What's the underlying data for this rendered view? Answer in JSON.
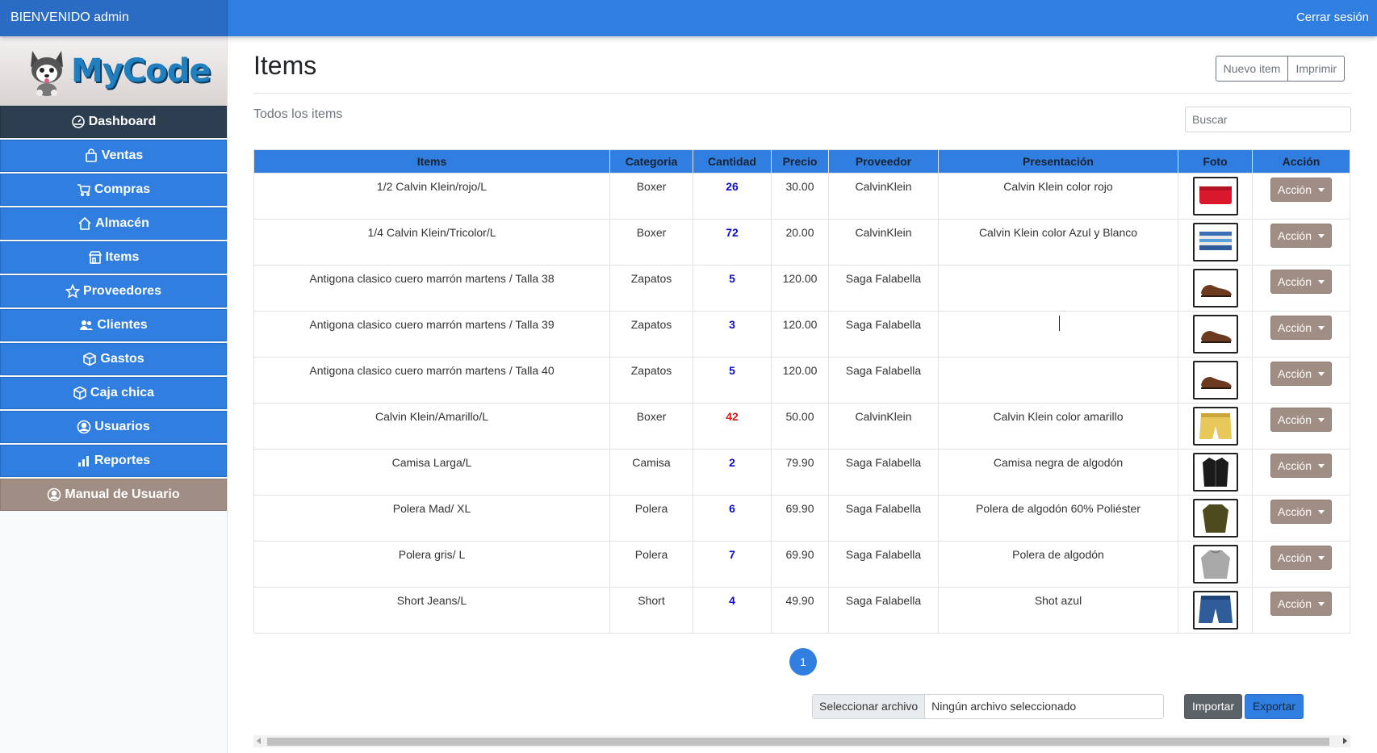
{
  "topbar": {
    "welcome": "BIENVENIDO admin",
    "logout": "Cerrar sesión"
  },
  "logo": {
    "text": "MyCode"
  },
  "sidebar": {
    "items": [
      {
        "label": "Dashboard",
        "icon": "dashboard-icon"
      },
      {
        "label": "Ventas",
        "icon": "shopping-bag-icon"
      },
      {
        "label": "Compras",
        "icon": "cart-icon"
      },
      {
        "label": "Almacén",
        "icon": "home-icon"
      },
      {
        "label": "Items",
        "icon": "shop-icon"
      },
      {
        "label": "Proveedores",
        "icon": "star-icon"
      },
      {
        "label": "Clientes",
        "icon": "people-icon"
      },
      {
        "label": "Gastos",
        "icon": "box-icon"
      },
      {
        "label": "Caja chica",
        "icon": "box-icon"
      },
      {
        "label": "Usuarios",
        "icon": "user-circle-icon"
      },
      {
        "label": "Reportes",
        "icon": "bar-chart-icon"
      },
      {
        "label": "Manual de Usuario",
        "icon": "user-circle-icon"
      }
    ]
  },
  "main": {
    "title": "Items",
    "buttons": {
      "new_item": "Nuevo item",
      "print": "Imprimir"
    },
    "subtitle": "Todos los items",
    "search_placeholder": "Buscar",
    "table": {
      "headers": [
        "Items",
        "Categoria",
        "Cantidad",
        "Precio",
        "Proveedor",
        "Presentación",
        "Foto",
        "Acción"
      ],
      "rows": [
        {
          "item": "1/2 Calvin Klein/rojo/L",
          "categoria": "Boxer",
          "cantidad": "26",
          "precio": "30.00",
          "proveedor": "CalvinKlein",
          "presentacion": "Calvin Klein color rojo",
          "accion": "Acción"
        },
        {
          "item": "1/4 Calvin Klein/Tricolor/L",
          "categoria": "Boxer",
          "cantidad": "72",
          "precio": "20.00",
          "proveedor": "CalvinKlein",
          "presentacion": "Calvin Klein color Azul y Blanco",
          "accion": "Acción"
        },
        {
          "item": "Antigona clasico cuero marrón martens / Talla 38",
          "categoria": "Zapatos",
          "cantidad": "5",
          "precio": "120.00",
          "proveedor": "Saga Falabella",
          "presentacion": "",
          "accion": "Acción"
        },
        {
          "item": "Antigona clasico cuero marrón martens / Talla 39",
          "categoria": "Zapatos",
          "cantidad": "3",
          "precio": "120.00",
          "proveedor": "Saga Falabella",
          "presentacion": "",
          "accion": "Acción"
        },
        {
          "item": "Antigona clasico cuero marrón martens / Talla 40",
          "categoria": "Zapatos",
          "cantidad": "5",
          "precio": "120.00",
          "proveedor": "Saga Falabella",
          "presentacion": "",
          "accion": "Acción"
        },
        {
          "item": "Calvin Klein/Amarillo/L",
          "categoria": "Boxer",
          "cantidad": "42",
          "precio": "50.00",
          "proveedor": "CalvinKlein",
          "presentacion": "Calvin Klein color amarillo",
          "accion": "Acción"
        },
        {
          "item": "Camisa Larga/L",
          "categoria": "Camisa",
          "cantidad": "2",
          "precio": "79.90",
          "proveedor": "Saga Falabella",
          "presentacion": "Camisa negra de algodón",
          "accion": "Acción"
        },
        {
          "item": "Polera Mad/ XL",
          "categoria": "Polera",
          "cantidad": "6",
          "precio": "69.90",
          "proveedor": "Saga Falabella",
          "presentacion": "Polera de algodón 60% Poliéster",
          "accion": "Acción"
        },
        {
          "item": "Polera gris/ L",
          "categoria": "Polera",
          "cantidad": "7",
          "precio": "69.90",
          "proveedor": "Saga Falabella",
          "presentacion": "Polera de algodón",
          "accion": "Acción"
        },
        {
          "item": "Short Jeans/L",
          "categoria": "Short",
          "cantidad": "4",
          "precio": "49.90",
          "proveedor": "Saga Falabella",
          "presentacion": "Shot azul",
          "accion": "Acción"
        }
      ]
    },
    "pagination": {
      "current": "1"
    },
    "file": {
      "button": "Seleccionar archivo",
      "status": "Ningún archivo seleccionado"
    },
    "actions": {
      "import": "Importar",
      "export": "Exportar"
    }
  },
  "colors": {
    "primary": "#2f7ee0",
    "sidebar_active": "#2c3e50",
    "accent_brown": "#a08d84",
    "qty_blue": "#0b0bc4",
    "qty_red": "#d61a1a"
  }
}
